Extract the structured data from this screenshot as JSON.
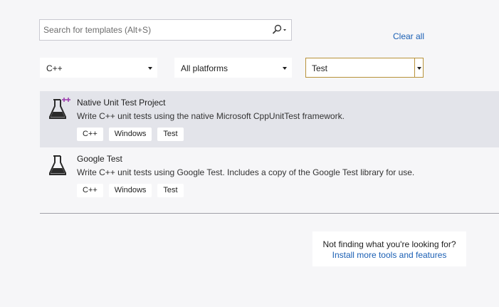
{
  "search": {
    "placeholder": "Search for templates (Alt+S)",
    "value": ""
  },
  "clear_all_label": "Clear all",
  "filters": {
    "language": "C++",
    "platform": "All platforms",
    "project_type": "Test"
  },
  "templates": [
    {
      "name": "Native Unit Test Project",
      "description": "Write C++ unit tests using the native Microsoft CppUnitTest framework.",
      "icon": "flask-plus-icon",
      "selected": true,
      "tags": [
        "C++",
        "Windows",
        "Test"
      ]
    },
    {
      "name": "Google Test",
      "description": "Write C++ unit tests using Google Test. Includes a copy of the Google Test library for use.",
      "icon": "flask-icon",
      "selected": false,
      "tags": [
        "C++",
        "Windows",
        "Test"
      ]
    }
  ],
  "help": {
    "question": "Not finding what you're looking for?",
    "link": "Install more tools and features"
  },
  "colors": {
    "accent_link": "#1a5fb4",
    "selected_row": "#e3e4ea",
    "focus_border": "#b8923a",
    "icon_plus": "#9b3fae"
  }
}
